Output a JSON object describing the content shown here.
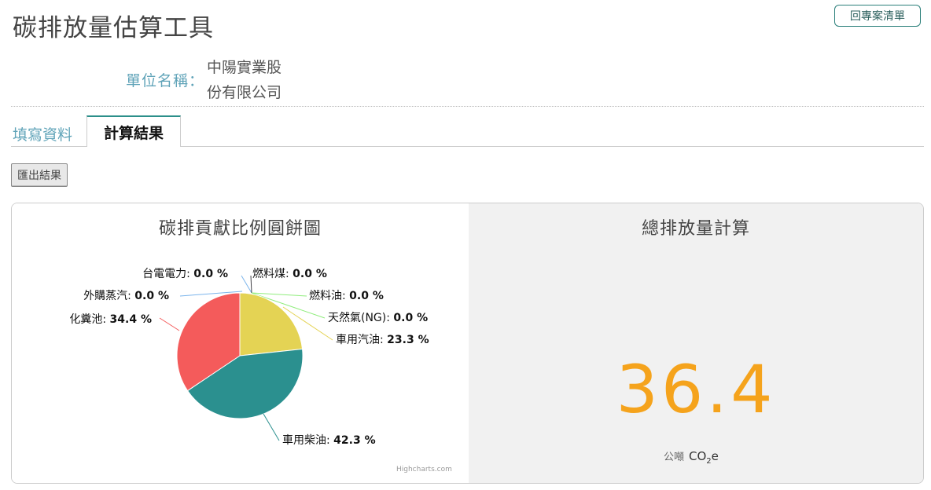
{
  "header": {
    "title": "碳排放量估算工具",
    "back_button": "回專案清單"
  },
  "unit": {
    "label": "單位名稱：",
    "value_line1": "中陽實業股",
    "value_line2": "份有限公司"
  },
  "tabs": [
    {
      "label": "填寫資料"
    },
    {
      "label": "計算結果"
    }
  ],
  "toolbar": {
    "export_label": "匯出結果"
  },
  "chart_panel": {
    "title": "碳排貢獻比例圓餅圖",
    "credits": "Highcharts.com"
  },
  "total_panel": {
    "title": "總排放量計算",
    "value": "36.4",
    "unit_cn": "公噸",
    "unit_co2": "CO",
    "unit_sub": "2",
    "unit_e": "e"
  },
  "chart_data": {
    "type": "pie",
    "title": "碳排貢獻比例圓餅圖",
    "series": [
      {
        "name": "台電電力",
        "value": 0.0,
        "label": "台電電力: 0.0 %",
        "color": "#7cb5ec"
      },
      {
        "name": "燃料煤",
        "value": 0.0,
        "label": "燃料煤: 0.0 %",
        "color": "#434348"
      },
      {
        "name": "燃料油",
        "value": 0.0,
        "label": "燃料油: 0.0 %",
        "color": "#90ed7d"
      },
      {
        "name": "天然氣(NG)",
        "value": 0.0,
        "label": "天然氣(NG): 0.0 %",
        "color": "#90ed7d"
      },
      {
        "name": "車用汽油",
        "value": 23.3,
        "label": "車用汽油: 23.3 %",
        "color": "#e4d354"
      },
      {
        "name": "車用柴油",
        "value": 42.3,
        "label": "車用柴油: 42.3 %",
        "color": "#2b908f"
      },
      {
        "name": "化糞池",
        "value": 34.4,
        "label": "化糞池: 34.4 %",
        "color": "#f45b5b"
      },
      {
        "name": "外購蒸汽",
        "value": 0.0,
        "label": "外購蒸汽: 0.0 %",
        "color": "#7cb5ec"
      }
    ]
  }
}
